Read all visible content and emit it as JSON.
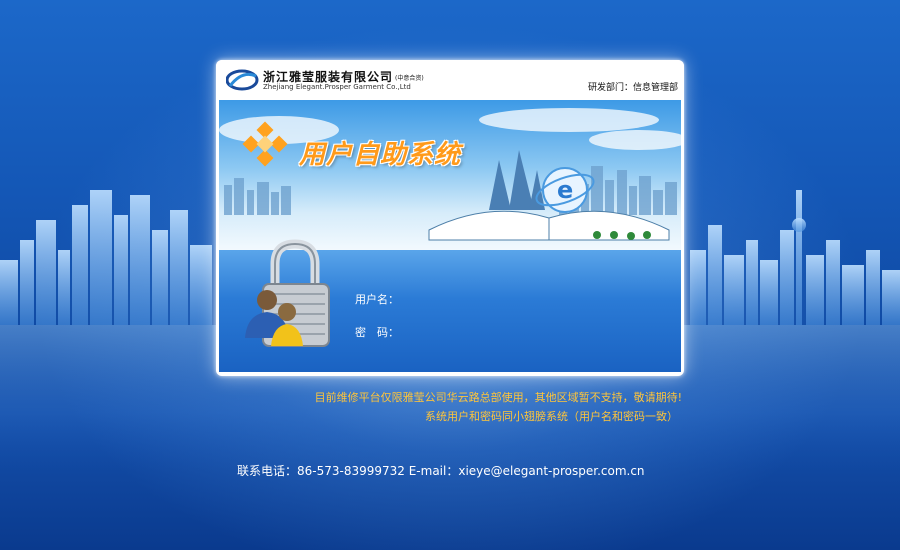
{
  "header": {
    "company_cn": "浙江雅莹服装有限公司",
    "company_tag": "(中意合资)",
    "company_en": "Zhejiang Elegant.Prosper Garment Co.,Ltd",
    "dept": "研发部门：信息管理部"
  },
  "banner": {
    "title": "用户自助系统"
  },
  "login": {
    "username_label": "用户名：",
    "password_label": "密　码："
  },
  "notes": {
    "line1": "目前维修平台仅限雅莹公司华云路总部使用，其他区域暂不支持，敬请期待!",
    "line2": "系统用户和密码同小翅膀系统（用户名和密码一致）"
  },
  "contact": {
    "text": "联系电话：86-573-83999732  E-mail：xieye@elegant-prosper.com.cn"
  },
  "colors": {
    "accent": "#ffc53a",
    "title": "#ff9a1a",
    "background": "#1457b6"
  },
  "icons": [
    "company-logo",
    "lock-with-users-icon",
    "ie-globe-icon",
    "building-decoration"
  ]
}
